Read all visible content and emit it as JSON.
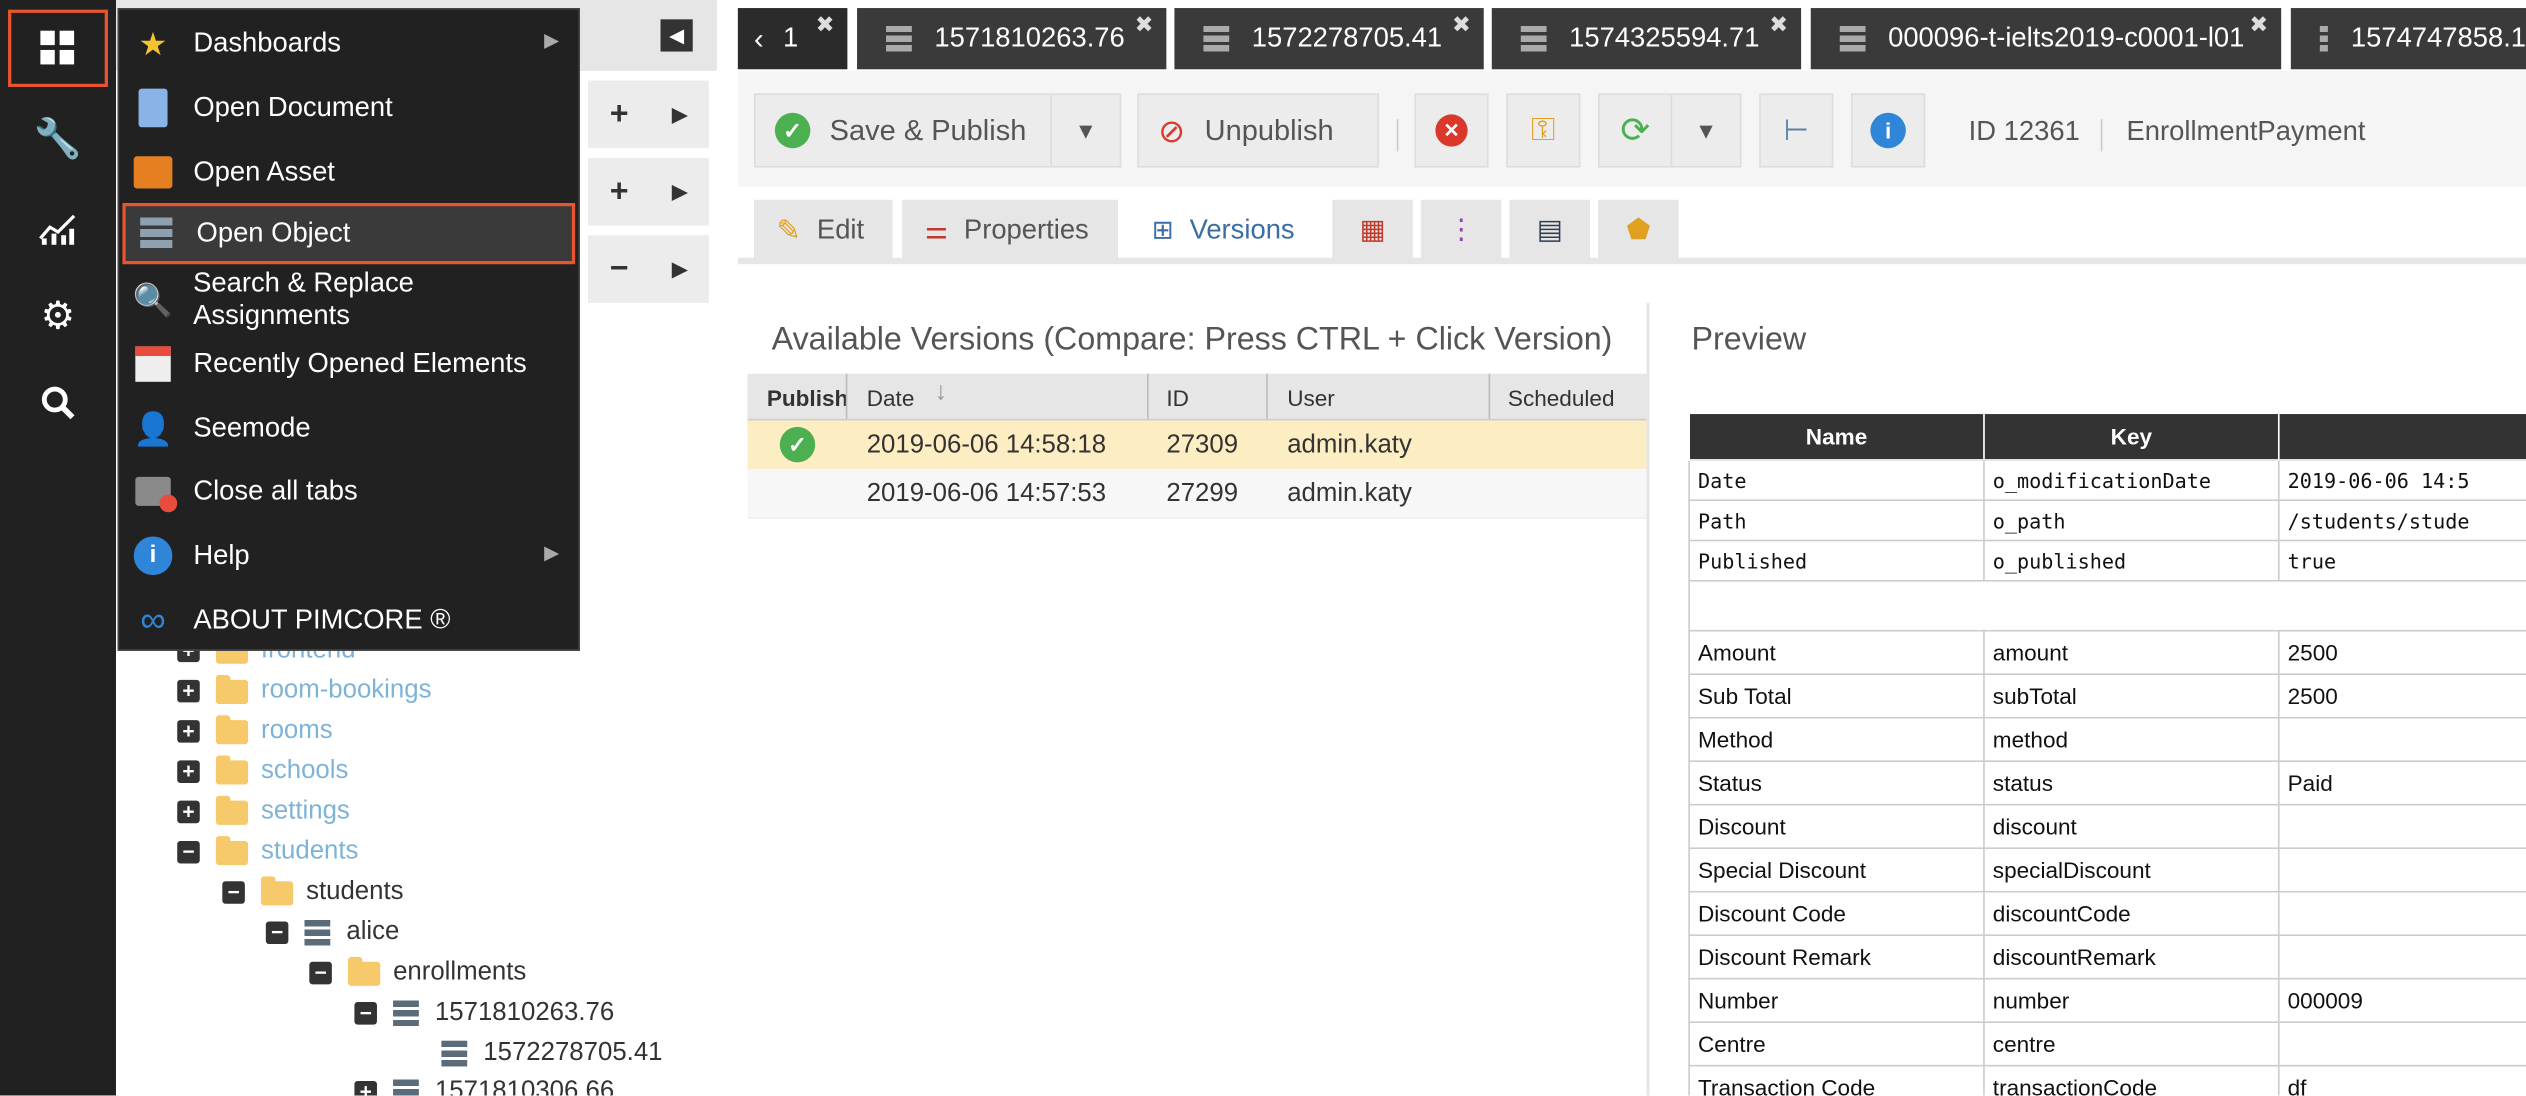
{
  "colors": {
    "accent": "#e8552e",
    "rail": "#212121",
    "selected_row": "#fdedc2",
    "link": "#7eb3d8"
  },
  "menu": {
    "items": [
      {
        "label": "Dashboards",
        "icon": "star-icon",
        "submenu": true
      },
      {
        "label": "Open Document",
        "icon": "document-icon",
        "submenu": false
      },
      {
        "label": "Open Asset",
        "icon": "image-icon",
        "submenu": false
      },
      {
        "label": "Open Object",
        "icon": "object-icon",
        "submenu": false
      },
      {
        "label": "Search & Replace Assignments",
        "icon": "search-replace-icon",
        "submenu": false
      },
      {
        "label": "Recently Opened Elements",
        "icon": "calendar-icon",
        "submenu": false
      },
      {
        "label": "Seemode",
        "icon": "person-icon",
        "submenu": false
      },
      {
        "label": "Close all tabs",
        "icon": "close-folder-icon",
        "submenu": false
      },
      {
        "label": "Help",
        "icon": "info-icon",
        "submenu": true
      },
      {
        "label": "ABOUT PIMCORE ®",
        "icon": "pimcore-logo-icon",
        "submenu": false
      }
    ]
  },
  "tree": {
    "items": [
      {
        "label": "frontend",
        "toggle": "+",
        "type": "folder",
        "link": true
      },
      {
        "label": "room-bookings",
        "toggle": "+",
        "type": "folder",
        "link": true
      },
      {
        "label": "rooms",
        "toggle": "+",
        "type": "folder",
        "link": true
      },
      {
        "label": "schools",
        "toggle": "+",
        "type": "folder",
        "link": true
      },
      {
        "label": "settings",
        "toggle": "+",
        "type": "folder",
        "link": true
      },
      {
        "label": "students",
        "toggle": "−",
        "type": "folder",
        "link": true
      },
      {
        "label": "students",
        "toggle": "−",
        "type": "folder",
        "link": false
      },
      {
        "label": "alice",
        "toggle": "−",
        "type": "object",
        "link": false
      },
      {
        "label": "enrollments",
        "toggle": "−",
        "type": "folder",
        "link": false
      },
      {
        "label": "1571810263.76",
        "toggle": "−",
        "type": "object",
        "link": false
      },
      {
        "label": "1572278705.41",
        "toggle": "",
        "type": "object",
        "link": false
      },
      {
        "label": "1571810306.66",
        "toggle": "+",
        "type": "object",
        "link": false
      }
    ]
  },
  "tabs": [
    {
      "label": "1"
    },
    {
      "label": "1571810263.76"
    },
    {
      "label": "1572278705.41"
    },
    {
      "label": "1574325594.71"
    },
    {
      "label": "000096-t-ielts2019-c0001-l01"
    },
    {
      "label": "1574747858.1"
    }
  ],
  "toolbar": {
    "save_publish": "Save & Publish",
    "unpublish": "Unpublish",
    "id": "ID 12361",
    "classname": "EnrollmentPayment"
  },
  "subtabs": {
    "edit": "Edit",
    "properties": "Properties",
    "versions": "Versions"
  },
  "versions": {
    "title": "Available Versions (Compare: Press CTRL + Click Version)",
    "columns": [
      "Publish",
      "Date",
      "ID",
      "User",
      "Scheduled"
    ],
    "rows": [
      {
        "date": "2019-06-06 14:58:18",
        "id": "27309",
        "user": "admin.katy",
        "published": true
      },
      {
        "date": "2019-06-06 14:57:53",
        "id": "27299",
        "user": "admin.katy",
        "published": false
      }
    ]
  },
  "preview": {
    "title": "Preview",
    "columns": [
      "Name",
      "Key",
      ""
    ],
    "meta_rows": [
      {
        "name": "Date",
        "key": "o_modificationDate",
        "value": "2019-06-06 14:5"
      },
      {
        "name": "Path",
        "key": "o_path",
        "value": "/students/stude"
      },
      {
        "name": "Published",
        "key": "o_published",
        "value": "true"
      }
    ],
    "rows": [
      {
        "name": "Amount",
        "key": "amount",
        "value": "2500"
      },
      {
        "name": "Sub Total",
        "key": "subTotal",
        "value": "2500"
      },
      {
        "name": "Method",
        "key": "method",
        "value": ""
      },
      {
        "name": "Status",
        "key": "status",
        "value": "Paid"
      },
      {
        "name": "Discount",
        "key": "discount",
        "value": ""
      },
      {
        "name": "Special Discount",
        "key": "specialDiscount",
        "value": ""
      },
      {
        "name": "Discount Code",
        "key": "discountCode",
        "value": ""
      },
      {
        "name": "Discount Remark",
        "key": "discountRemark",
        "value": ""
      },
      {
        "name": "Number",
        "key": "number",
        "value": "000009"
      },
      {
        "name": "Centre",
        "key": "centre",
        "value": ""
      },
      {
        "name": "Transaction Code",
        "key": "transactionCode",
        "value": "df"
      }
    ]
  }
}
